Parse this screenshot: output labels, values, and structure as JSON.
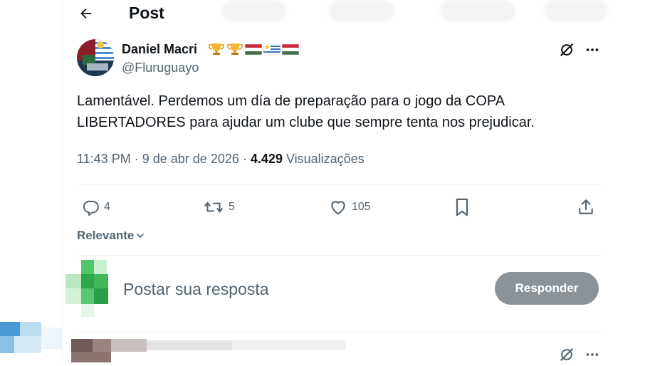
{
  "header": {
    "title": "Post",
    "back_icon": "arrow-left-icon"
  },
  "post": {
    "author_name": "Daniel Macri",
    "author_handle": "@Fluruguayo",
    "badges": [
      "trophy",
      "trophy",
      "flag-hungary",
      "flag-uruguay",
      "flag-hungary"
    ],
    "text": "Lamentável. Perdemos um día de preparação para o jogo da COPA LIBERTADORES para ajudar um clube que sempre tenta nos prejudicar.",
    "time": "11:43 PM",
    "separator": "·",
    "date": "9 de abr de 2026",
    "views_count": "4.429",
    "views_label": "Visualizações"
  },
  "actions": {
    "replies": "4",
    "reposts": "5",
    "likes": "105"
  },
  "replies_section": {
    "sort_label": "Relevante",
    "placeholder": "Postar sua resposta",
    "reply_button": "Responder"
  },
  "colors": {
    "text_primary": "#0f1419",
    "text_secondary": "#536471",
    "divider": "#eff3f4",
    "reply_button_bg": "#8b9399"
  }
}
